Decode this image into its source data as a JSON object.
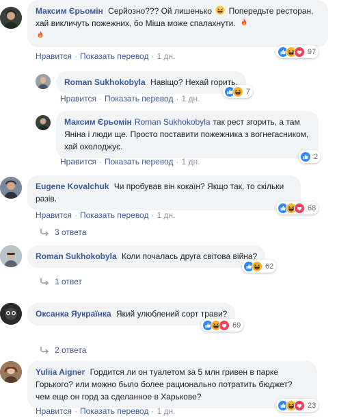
{
  "actions": {
    "like": "Нравится",
    "translate": "Показать перевод",
    "dot": "·"
  },
  "colors": {
    "like": "#2d88ff",
    "haha": "#f7b125",
    "love": "#f33e58",
    "link": "#385898",
    "bubble": "#f2f3f5",
    "meta": "#90949c"
  },
  "comments": [
    {
      "author": "Максим Єрьомін",
      "text_a": "Серйозно??? Ой лишенько",
      "text_b": "Попередьте ресторан, хай викличуть пожежних, бо Міша може спалахнути.",
      "time": "1 дн.",
      "reaction_count": "97",
      "reactions": [
        "like",
        "haha",
        "love"
      ]
    },
    {
      "author": "Roman Sukhokobyla",
      "text": "Навіщо? Нехай горить.",
      "time": "1 дн.",
      "reaction_count": "7",
      "reactions": [
        "like",
        "haha"
      ]
    },
    {
      "author": "Максим Єрьомін",
      "mention": "Roman Sukhokobyla",
      "text": "так рест згорить, а там Яніна і люди ще. Просто поставити пожежника з вогнегасником, хай охолоджує.",
      "time": "1 дн.",
      "reaction_count": "2",
      "reactions": [
        "like"
      ]
    },
    {
      "author": "Eugene Kovalchuk",
      "text": "Чи пробував він кокаїн? Якщо так, то скільки разів.",
      "time": "1 дн.",
      "reaction_count": "68",
      "reactions": [
        "like",
        "haha",
        "love"
      ],
      "replies": "3 ответа"
    },
    {
      "author": "Roman Sukhokobyla",
      "text": "Коли почалась друга світова війна?",
      "reaction_count": "62",
      "reactions": [
        "like",
        "haha"
      ],
      "replies": "1 ответ"
    },
    {
      "author": "Оксанка Яукраїнка",
      "text": "Який улюблений сорт трави?",
      "reaction_count": "69",
      "reactions": [
        "like",
        "haha",
        "love"
      ],
      "replies": "2 ответа"
    },
    {
      "author": "Yuliia Aigner",
      "text": "Гордится ли он туалетом за 5 млн гривен в парке Горького? или можно было более рационально потратить бюджет? чем еще он горд за сделанное в Харькове?",
      "time": "1 дн.",
      "reaction_count": "23",
      "reactions": [
        "like",
        "haha",
        "love"
      ]
    }
  ]
}
